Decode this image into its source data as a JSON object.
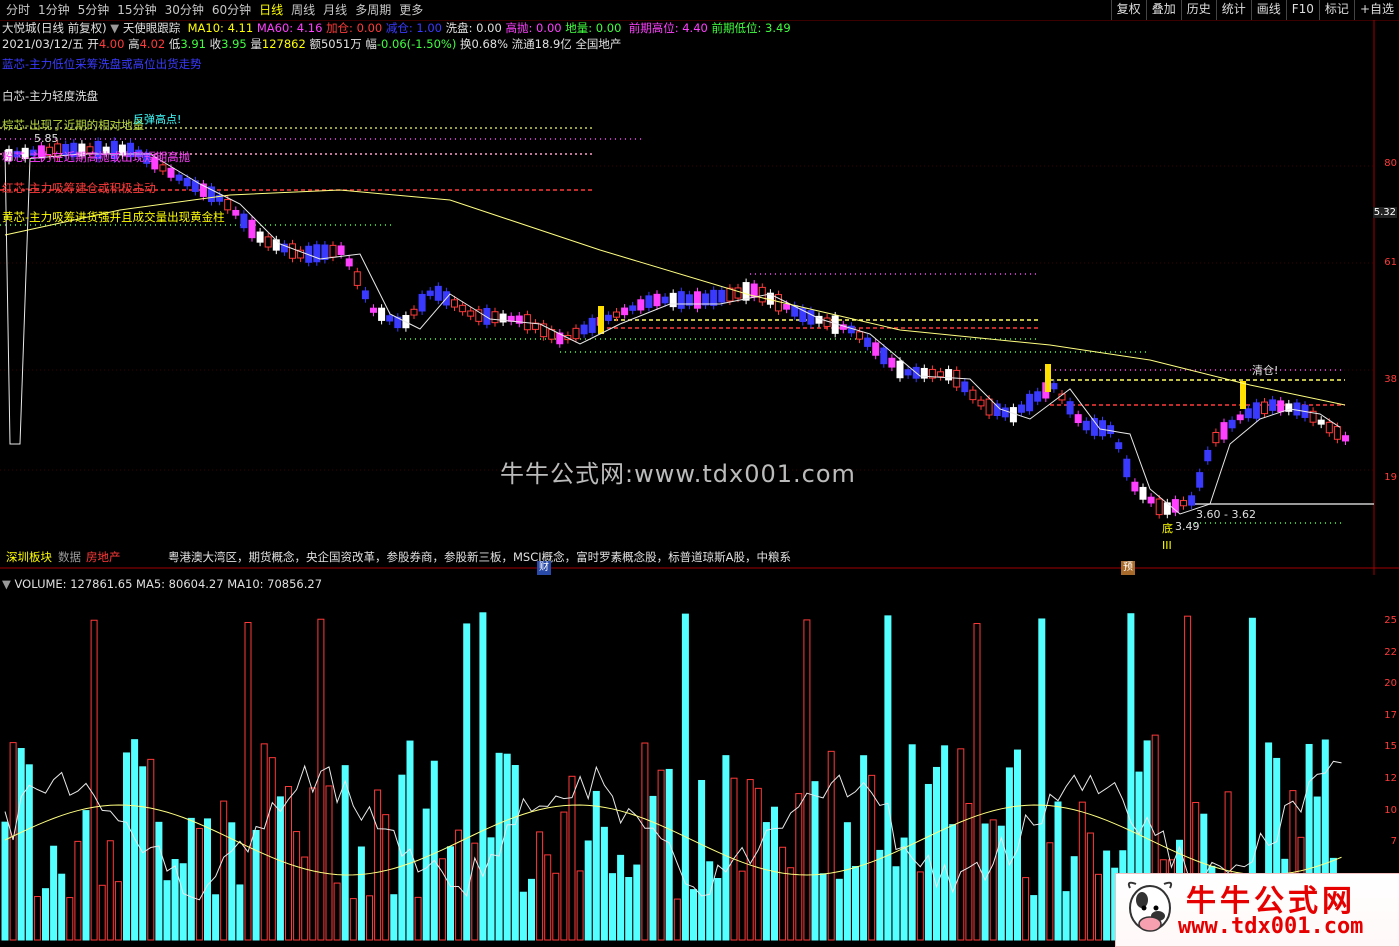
{
  "timeframes": [
    "分时",
    "1分钟",
    "5分钟",
    "15分钟",
    "30分钟",
    "60分钟",
    "日线",
    "周线",
    "月线",
    "多周期",
    "更多"
  ],
  "active_timeframe": "日线",
  "toolbar": [
    "复权",
    "叠加",
    "历史",
    "统计",
    "画线",
    "F10",
    "标记",
    "+自选"
  ],
  "stock": {
    "name": "大悦城(日线 前复权)",
    "indicator_name": "天使眼跟踪",
    "ma10": "MA10: 4.11",
    "ma60": "MA60: 4.16",
    "jiacang": "加仓: 0.00",
    "jiancang": "减仓: 1.00",
    "xipan": "洗盘: 0.00",
    "gaopao": "高抛: 0.00",
    "diliang": "地量: 0.00",
    "qianqi_high": "前期高位: 4.40",
    "qianqi_low": "前期低位: 3.49"
  },
  "bar_info": {
    "date": "2021/03/12/五",
    "open_lbl": "开",
    "open": "4.00",
    "high_lbl": "高",
    "high": "4.02",
    "low_lbl": "低",
    "low": "3.91",
    "close_lbl": "收",
    "close": "3.95",
    "vol_lbl": "量",
    "vol": "127862",
    "amount": "额5051万",
    "change_lbl": "幅",
    "change": "-0.06(-1.50%)",
    "turnover": "换0.68%",
    "float": "流通18.9亿",
    "sector": "全国地产"
  },
  "legends": {
    "blue": "蓝芯-主力低位采筹洗盘或高位出货走势",
    "white": "白芯-主力轻度洗盘",
    "brown": "棕芯-出现了近期的相对地量",
    "pink": "粉芯-主力在近期高抛或出现短期高抛",
    "red": "红芯-主力吸筹建仓或积极主动",
    "yellow": "黄芯-主力吸筹进货强并且成交量出现黄金柱"
  },
  "annotations": {
    "rebound_high": "反弹高点!",
    "high_price": "5.85",
    "clear_pos": "清仓!",
    "bottom": "底",
    "bottom_price": "3.49",
    "bottom_num": "III",
    "range": "3.60 - 3.62",
    "cai_badge": "财",
    "yu_badge": "预"
  },
  "sector_bar": {
    "left1": "深圳板块",
    "left2": "数据",
    "industry": "房地产",
    "concepts": "粤港澳大湾区，期货概念，央企国资改革，参股券商，参股新三板，MSCI概念，富时罗素概念股，标普道琼斯A股，中粮系"
  },
  "price_axis": [
    "80",
    "61",
    "38",
    "19"
  ],
  "price_current": "5.32",
  "watermark": "牛牛公式网:www.tdx001.com",
  "volume": {
    "header": "VOLUME: 127861.65  MA5: 80604.27  MA10: 70856.27",
    "axis": [
      "25",
      "22",
      "20",
      "17",
      "15",
      "12",
      "10",
      "7"
    ]
  },
  "logo": {
    "main": "牛牛公式网",
    "url": "www.tdx001.com"
  },
  "colors": {
    "up": "#ff3a3a",
    "down_cyan": "#54ffff",
    "ma_yellow": "#ffff80",
    "ma_white": "#e8e8e8"
  }
}
